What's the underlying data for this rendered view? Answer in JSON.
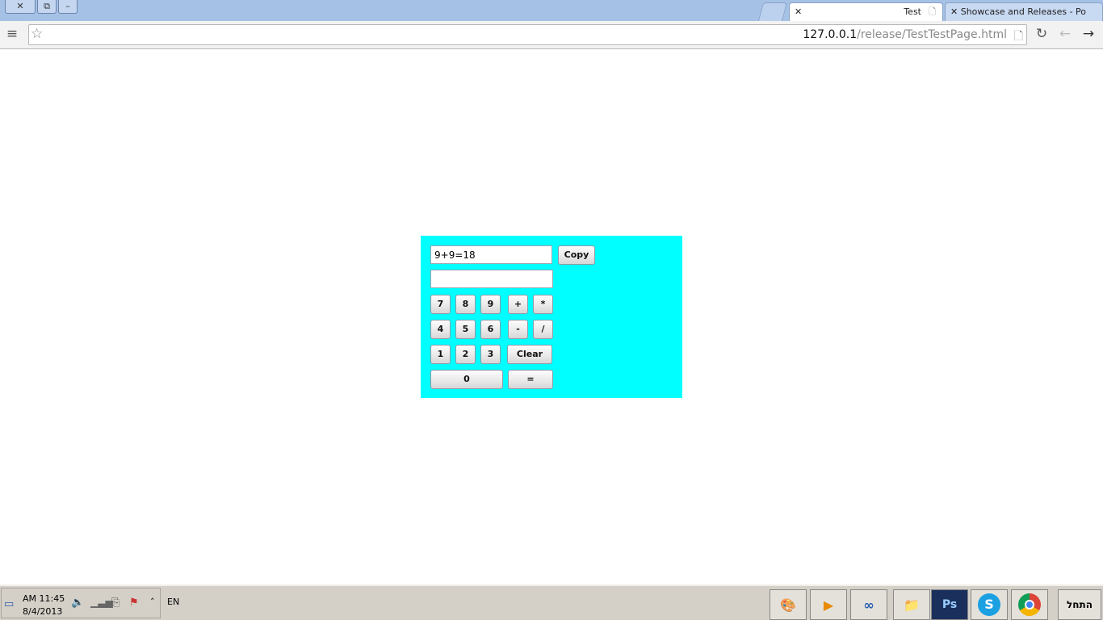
{
  "browser": {
    "window_controls": [
      "close",
      "restore",
      "minimize"
    ],
    "tabs": [
      {
        "title": "Test",
        "active": true
      },
      {
        "title": "Showcase and Releases - Po",
        "active": false
      }
    ],
    "url_host": "127.0.0.1",
    "url_path": "/release/TestTestPage.html"
  },
  "calculator": {
    "background": "#00ffff",
    "display_value": "9+9=18",
    "input_value": "",
    "copy_label": "Copy",
    "buttons": {
      "b7": "7",
      "b8": "8",
      "b9": "9",
      "plus": "+",
      "times": "*",
      "b4": "4",
      "b5": "5",
      "b6": "6",
      "minus": "-",
      "divide": "/",
      "b1": "1",
      "b2": "2",
      "b3": "3",
      "clear": "Clear",
      "b0": "0",
      "equals": "="
    }
  },
  "taskbar": {
    "time": "AM 11:45",
    "date": "8/4/2013",
    "language": "EN",
    "start_label": "התחל",
    "apps": [
      "paint",
      "media-player",
      "infinity-app",
      "file-explorer",
      "photoshop",
      "skype",
      "chrome"
    ]
  }
}
